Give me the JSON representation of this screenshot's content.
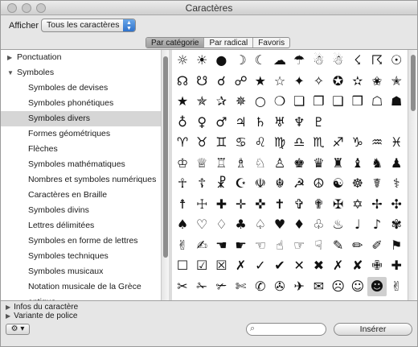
{
  "window": {
    "title": "Caractères"
  },
  "toolbar": {
    "afficher_label": "Afficher :",
    "afficher_value": "Tous les caractères"
  },
  "tabs": [
    {
      "label": "Par catégorie",
      "active": true
    },
    {
      "label": "Par radical",
      "active": false
    },
    {
      "label": "Favoris",
      "active": false
    }
  ],
  "sidebar": {
    "items": [
      {
        "label": "Ponctuation",
        "level": 0,
        "disclosure": "▶"
      },
      {
        "label": "Symboles",
        "level": 0,
        "disclosure": "▼"
      },
      {
        "label": "Symboles de devises",
        "level": 1
      },
      {
        "label": "Symboles phonétiques",
        "level": 1
      },
      {
        "label": "Symboles divers",
        "level": 1,
        "selected": true
      },
      {
        "label": "Formes géométriques",
        "level": 1
      },
      {
        "label": "Flèches",
        "level": 1
      },
      {
        "label": "Symboles mathématiques",
        "level": 1
      },
      {
        "label": "Nombres et symboles numériques",
        "level": 1
      },
      {
        "label": "Caractères en Braille",
        "level": 1
      },
      {
        "label": "Symboles divins",
        "level": 1
      },
      {
        "label": "Lettres délimitées",
        "level": 1
      },
      {
        "label": "Symboles en forme de lettres",
        "level": 1
      },
      {
        "label": "Symboles techniques",
        "level": 1
      },
      {
        "label": "Symboles musicaux",
        "level": 1
      },
      {
        "label": "Notation musicale de la Grèce antique",
        "level": 1
      }
    ]
  },
  "grid": {
    "rows": [
      [
        "☼",
        "☀",
        "●",
        "☽",
        "☾",
        "☁",
        "☂",
        "☃",
        "☃",
        "☇",
        "☈",
        "☉"
      ],
      [
        "☊",
        "☋",
        "☌",
        "☍",
        "★",
        "☆",
        "✦",
        "✧",
        "✪",
        "✫",
        "✬",
        "✭"
      ],
      [
        "★",
        "✯",
        "✰",
        "✵",
        "○",
        "❍",
        "❏",
        "❐",
        "❑",
        "❒",
        "☖",
        "☗"
      ],
      [
        "♁",
        "♀",
        "♂",
        "♃",
        "♄",
        "♅",
        "♆",
        "♇",
        "",
        "",
        "",
        ""
      ],
      [
        "♈",
        "♉",
        "♊",
        "♋",
        "♌",
        "♍",
        "♎",
        "♏",
        "♐",
        "♑",
        "♒",
        "♓"
      ],
      [
        "♔",
        "♕",
        "♖",
        "♗",
        "♘",
        "♙",
        "♚",
        "♛",
        "♜",
        "♝",
        "♞",
        "♟"
      ],
      [
        "☥",
        "☦",
        "☧",
        "☪",
        "☫",
        "☬",
        "☭",
        "☮",
        "☯",
        "☸",
        "☤",
        "⚕"
      ],
      [
        "☨",
        "☩",
        "✚",
        "✛",
        "✜",
        "✝",
        "✞",
        "✟",
        "✠",
        "✡",
        "✢",
        "✣"
      ],
      [
        "♠",
        "♡",
        "♢",
        "♣",
        "♤",
        "♥",
        "♦",
        "♧",
        "♨",
        "♩",
        "♪",
        "✾"
      ],
      [
        "✌",
        "✍",
        "☚",
        "☛",
        "☜",
        "☝",
        "☞",
        "☟",
        "✎",
        "✏",
        "✐",
        "⚑"
      ],
      [
        "☐",
        "☑",
        "☒",
        "✗",
        "✓",
        "✔",
        "✕",
        "✖",
        "✗",
        "✘",
        "✙",
        "✚"
      ],
      [
        "✂",
        "✁",
        "✃",
        "✄",
        "✆",
        "✇",
        "✈",
        "✉",
        "☹",
        "☺",
        "☻",
        "✌"
      ]
    ],
    "selected": {
      "row": 11,
      "col": 10
    }
  },
  "bottom": {
    "info_label": "Infos du caractère",
    "variant_label": "Variante de police",
    "gear_label": "⚙ ▾",
    "insert_label": "Insérer",
    "search_placeholder": ""
  }
}
